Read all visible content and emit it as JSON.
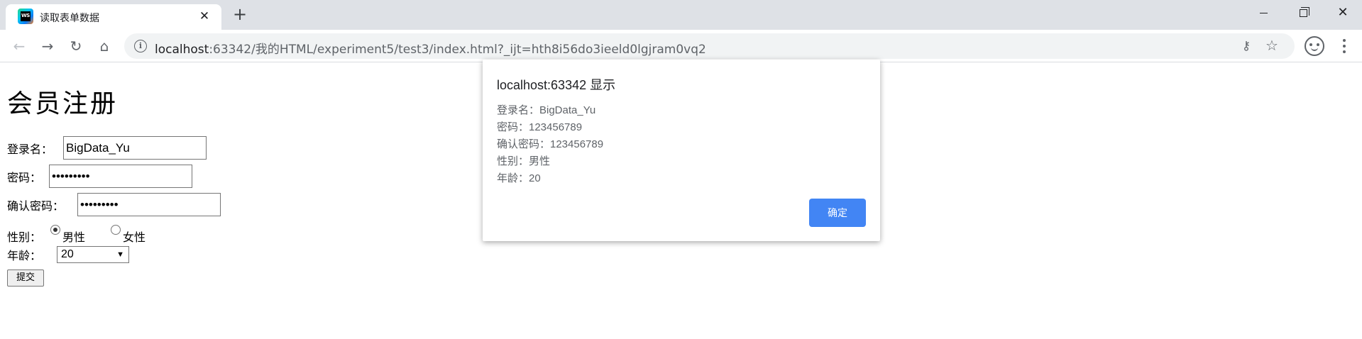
{
  "browser": {
    "tab": {
      "title": "读取表单数据",
      "favicon_text": "WS",
      "close_glyph": "✕"
    },
    "new_tab_glyph": "+",
    "window": {
      "min": "",
      "max": "",
      "close": "✕"
    },
    "nav": {
      "back": "←",
      "forward": "→",
      "reload": "↻",
      "home": "⌂"
    },
    "omnibox": {
      "info_glyph": "i",
      "host": "localhost",
      "rest": ":63342/我的HTML/experiment5/test3/index.html?_ijt=hth8i56do3ieeld0lgjram0vq2",
      "key_glyph": "⚷",
      "star_glyph": "☆"
    }
  },
  "form": {
    "title": "会员注册",
    "login_label": "登录名：",
    "login_value": "BigData_Yu",
    "password_label": "密码：",
    "password_value": "•••••••••",
    "confirm_label": "确认密码：",
    "confirm_value": "•••••••••",
    "gender_label": "性别：",
    "gender_options": [
      "男性",
      "女性"
    ],
    "gender_selected": "男性",
    "age_label": "年龄：",
    "age_value": "20",
    "age_caret": "▼",
    "submit_label": "提交"
  },
  "dialog": {
    "title": "localhost:63342 显示",
    "lines": [
      "登录名：BigData_Yu",
      "密码：123456789",
      "确认密码：123456789",
      "性别：男性",
      "年龄：20"
    ],
    "ok_label": "确定"
  },
  "colors": {
    "accent": "#4285f4",
    "tabstrip": "#dee1e6",
    "omnibox": "#f1f3f4"
  }
}
